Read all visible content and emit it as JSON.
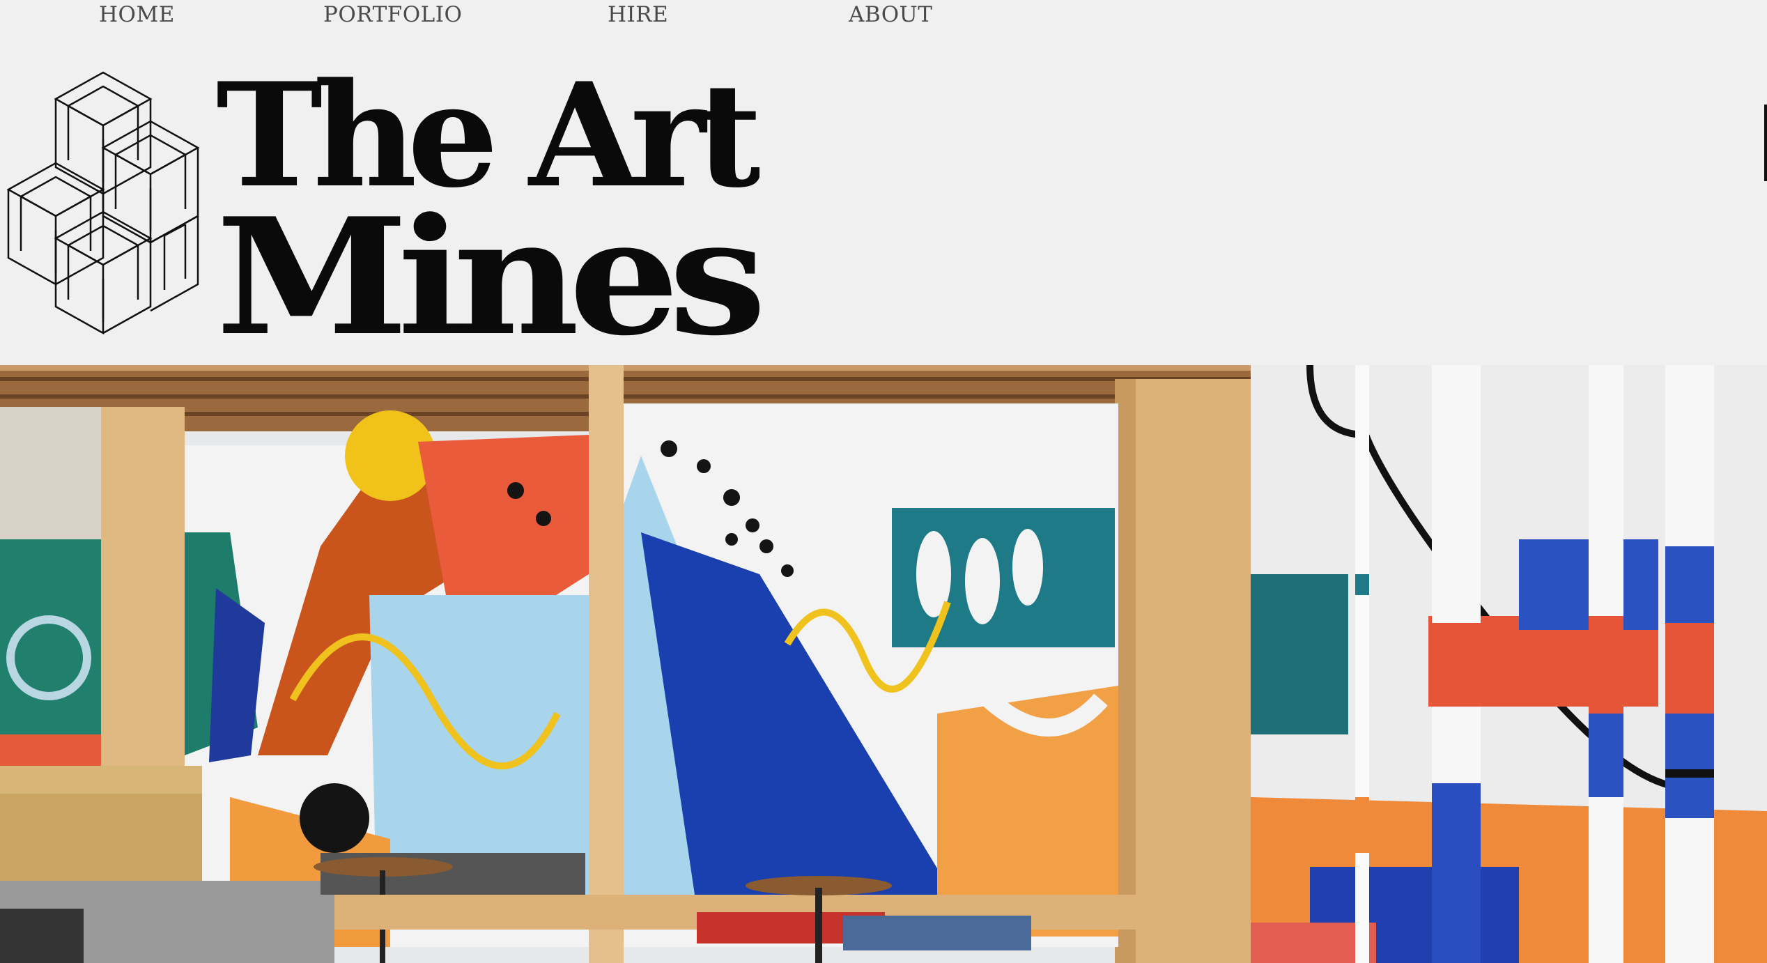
{
  "nav": {
    "home": "HOME",
    "portfolio": "PORTFOLIO",
    "hire": "HIRE",
    "about": "ABOUT"
  },
  "logo": {
    "line1": "The Art",
    "line2": "Mines",
    "mark_icon": "isometric-cube-lattice-icon"
  },
  "colors": {
    "background": "#f0f0f0",
    "nav_text": "#4a4a4a",
    "logo": "#0a0a0a"
  },
  "hero": {
    "description_icon": "colorful-mural-photo"
  }
}
